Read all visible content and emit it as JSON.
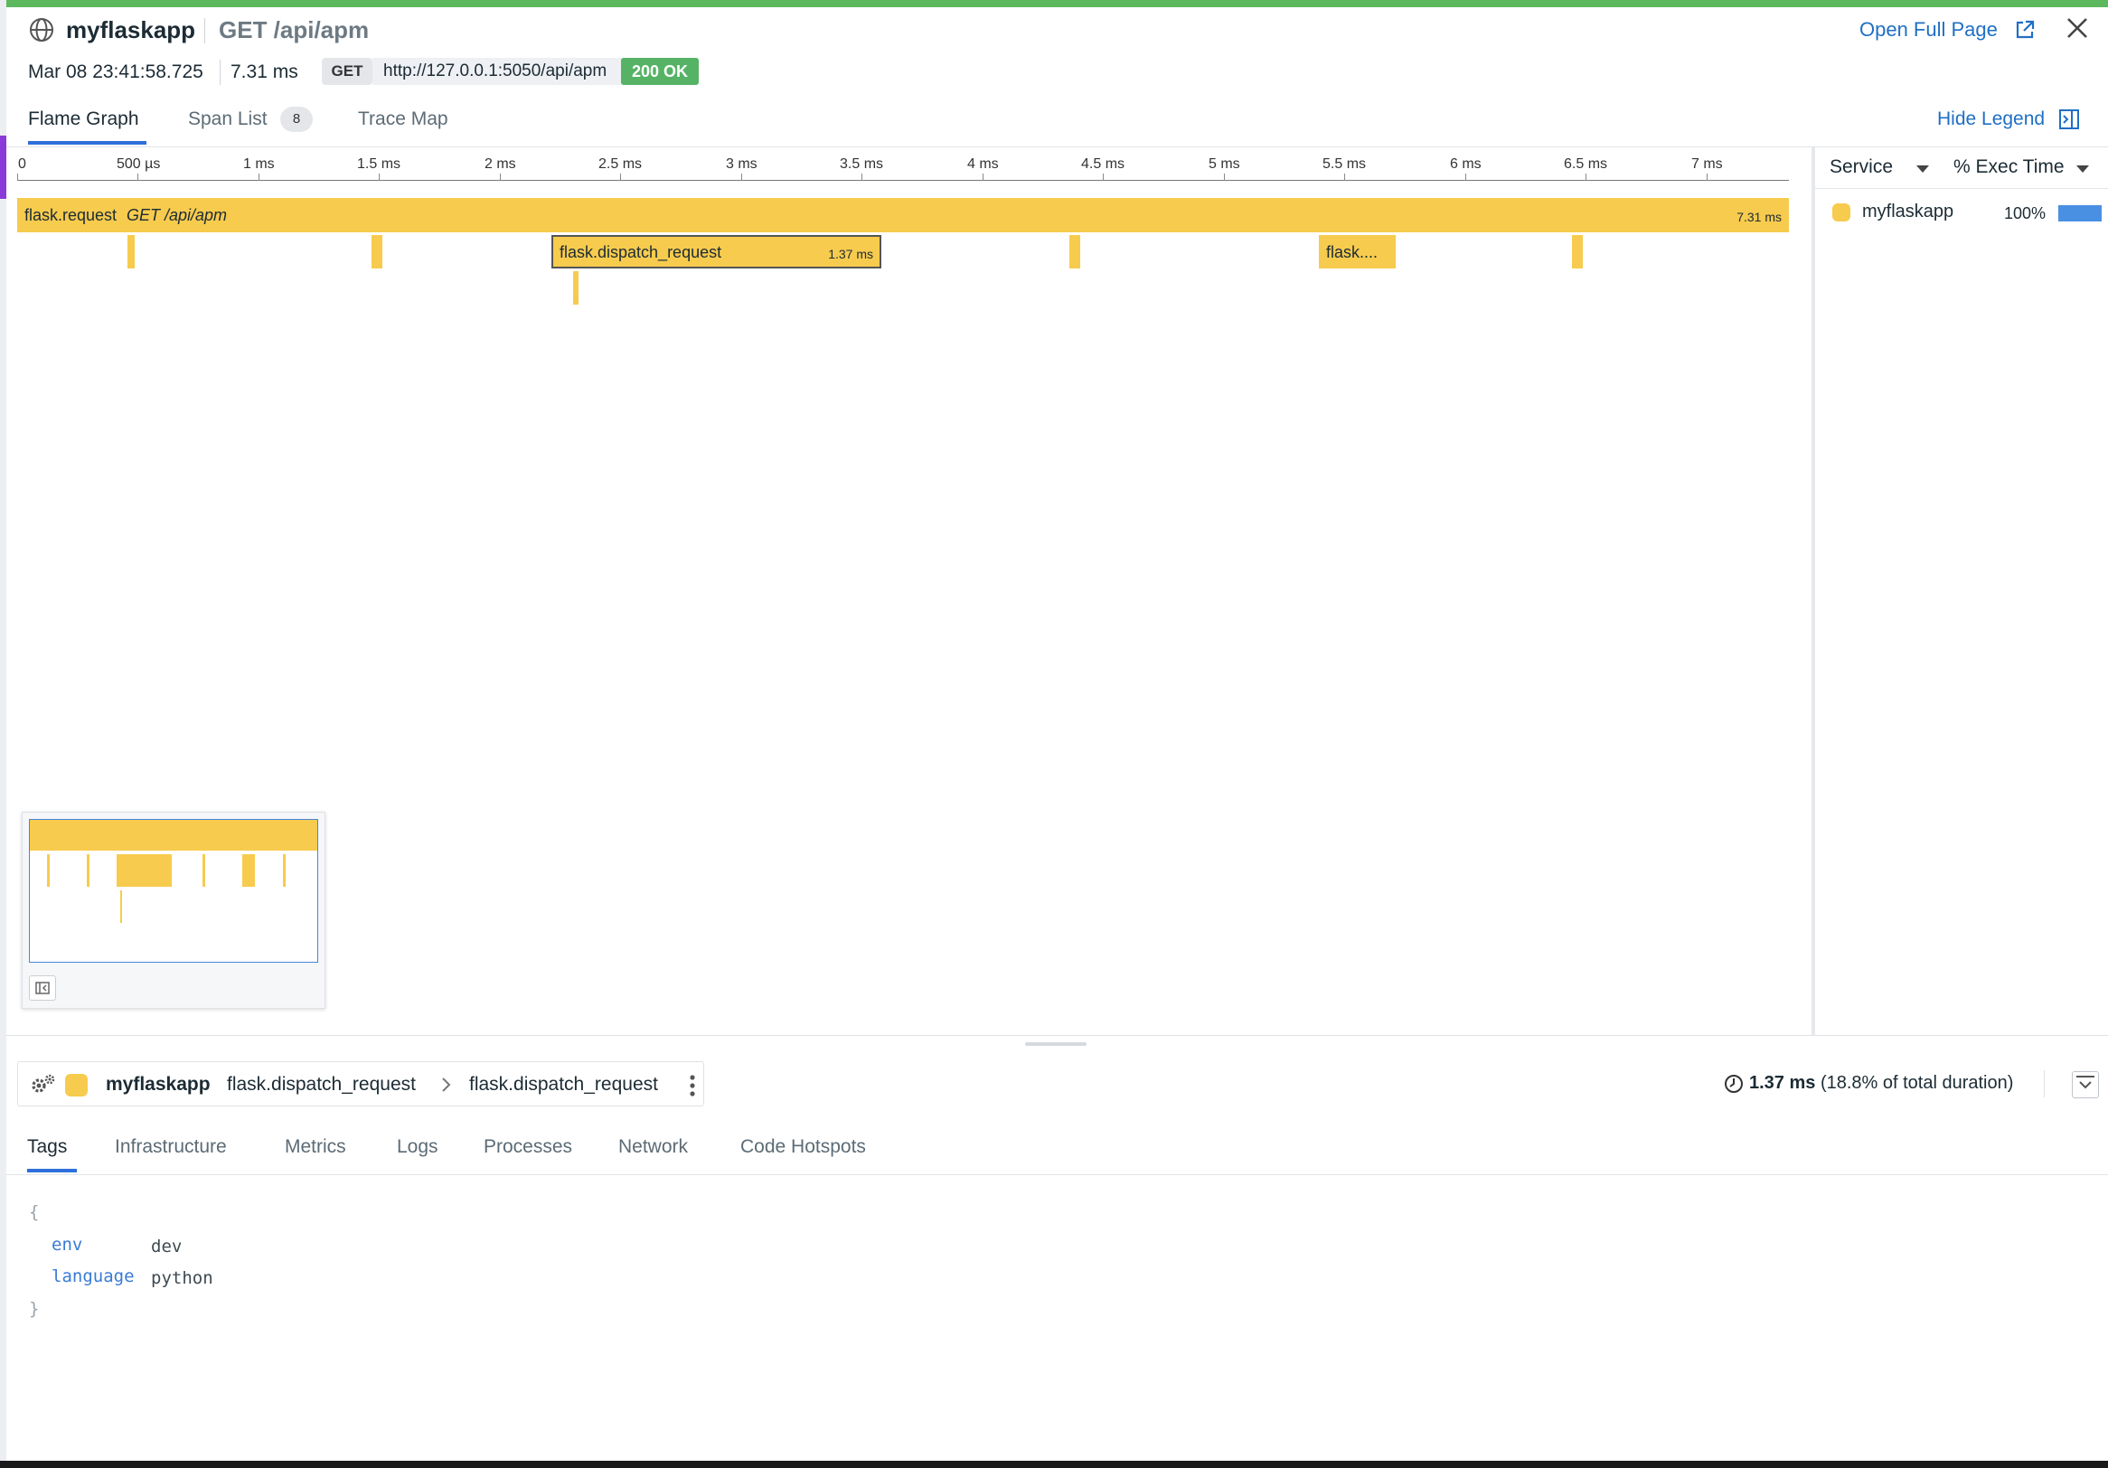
{
  "header": {
    "service": "myflaskapp",
    "route": "GET /api/apm",
    "open_full_page": "Open Full Page"
  },
  "meta": {
    "timestamp": "Mar 08 23:41:58.725",
    "duration": "7.31 ms",
    "method": "GET",
    "url": "http://127.0.0.1:5050/api/apm",
    "status": "200 OK"
  },
  "tabs": {
    "flame_graph": "Flame Graph",
    "span_list": "Span List",
    "span_list_count": "8",
    "trace_map": "Trace Map",
    "hide_legend": "Hide Legend"
  },
  "axis": {
    "labels": [
      "0",
      "500 µs",
      "1 ms",
      "1.5 ms",
      "2 ms",
      "2.5 ms",
      "3 ms",
      "3.5 ms",
      "4 ms",
      "4.5 ms",
      "5 ms",
      "5.5 ms",
      "6 ms",
      "6.5 ms",
      "7 ms"
    ]
  },
  "flame": {
    "root_name": "flask.request",
    "root_resource": "GET /api/apm",
    "root_duration": "7.31 ms",
    "dispatch_name": "flask.dispatch_request",
    "dispatch_duration": "1.37 ms",
    "truncated_name": "flask...."
  },
  "legend": {
    "service_header": "Service",
    "exec_header": "% Exec Time",
    "service_name": "myflaskapp",
    "service_pct": "100%",
    "service_color": "#f7cb4d",
    "bar_color": "#4a90e2"
  },
  "detail": {
    "service": "myflaskapp",
    "operation": "flask.dispatch_request",
    "resource": "flask.dispatch_request",
    "duration": "1.37 ms",
    "duration_pct": "(18.8% of total duration)",
    "tabs": [
      "Tags",
      "Infrastructure",
      "Metrics",
      "Logs",
      "Processes",
      "Network",
      "Code Hotspots"
    ]
  },
  "tags": {
    "open_brace": "{",
    "close_brace": "}",
    "rows": [
      {
        "key": "env",
        "value": "dev"
      },
      {
        "key": "language",
        "value": "python"
      }
    ]
  }
}
